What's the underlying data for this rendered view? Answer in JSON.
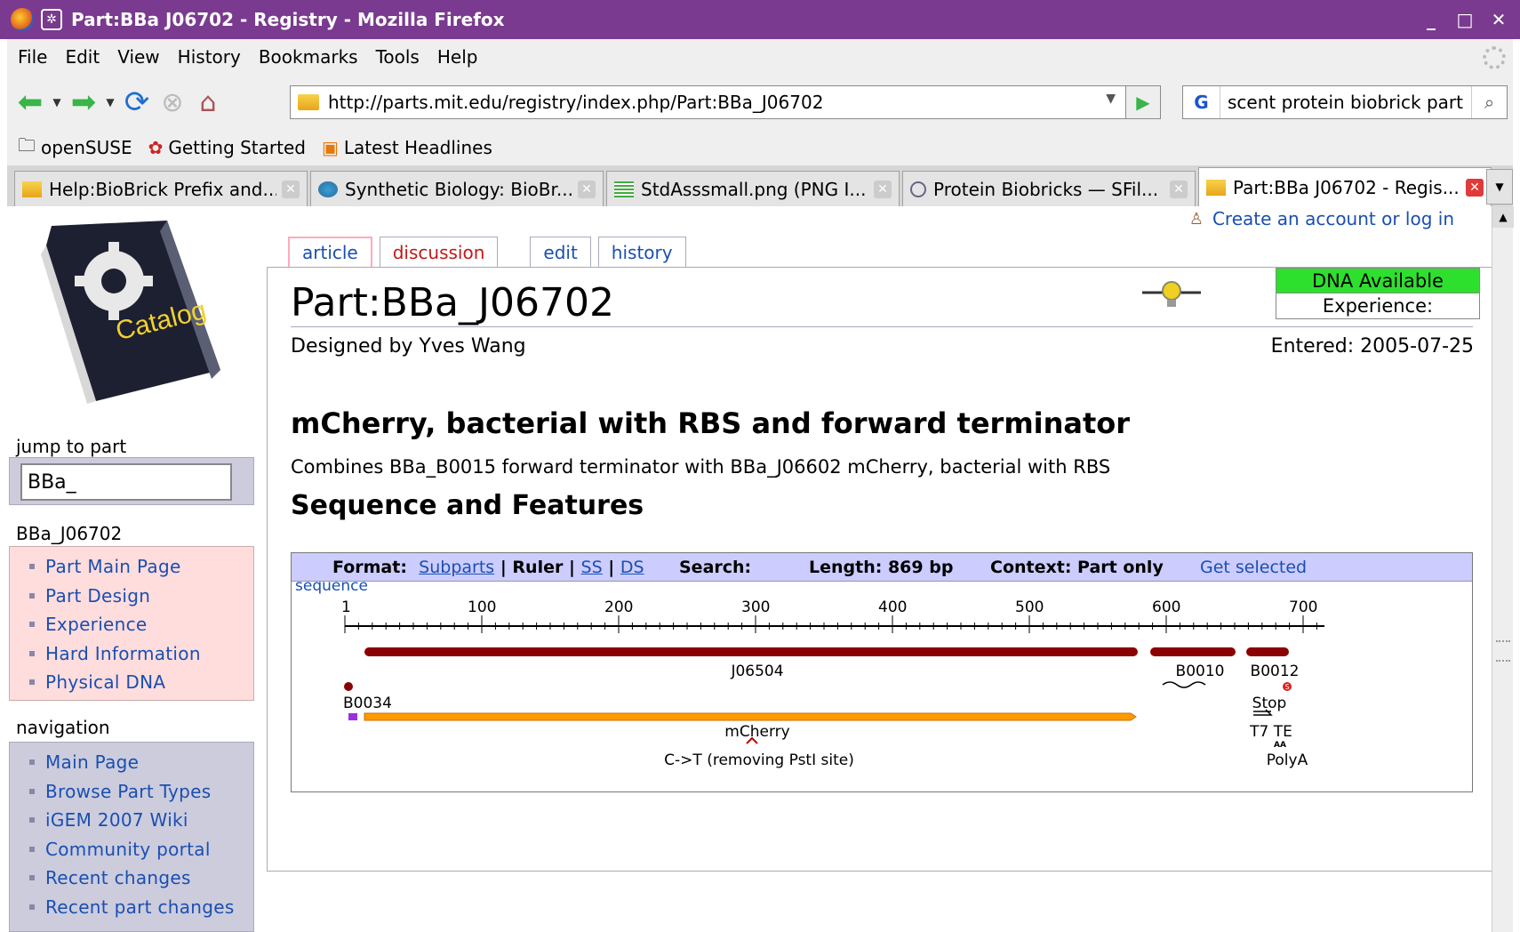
{
  "window": {
    "title": "Part:BBa J06702 - Registry - Mozilla Firefox",
    "controls": [
      "_",
      "□",
      "✕"
    ]
  },
  "menu": [
    "File",
    "Edit",
    "View",
    "History",
    "Bookmarks",
    "Tools",
    "Help"
  ],
  "nav": {
    "url": "http://parts.mit.edu/registry/index.php/Part:BBa_J06702",
    "search_engine": "G",
    "search_query": "scent protein biobrick part"
  },
  "bookmarks": [
    "openSUSE",
    "Getting Started",
    "Latest Headlines"
  ],
  "tabs": [
    {
      "label": "Help:BioBrick Prefix and...",
      "active": false
    },
    {
      "label": "Synthetic Biology: BioBr...",
      "active": false
    },
    {
      "label": "StdAsssmall.png (PNG I...",
      "active": false
    },
    {
      "label": "Protein Biobricks — SFil...",
      "active": false
    },
    {
      "label": "Part:BBa J06702 - Regis...",
      "active": true
    }
  ],
  "sidebar": {
    "logo_text": "Catalog",
    "jump_label": "jump to part",
    "jump_value": "BBa_",
    "part_label": "BBa_J06702",
    "part_links": [
      "Part Main Page",
      "Part Design",
      "Experience",
      "Hard Information",
      "Physical DNA"
    ],
    "nav_label": "navigation",
    "nav_links": [
      "Main Page",
      "Browse Part Types",
      "iGEM 2007 Wiki",
      "Community portal",
      "Recent changes",
      "Recent part changes"
    ]
  },
  "login": "Create an account or log in",
  "page_tabs": [
    "article",
    "discussion",
    "edit",
    "history"
  ],
  "article": {
    "title": "Part:BBa_J06702",
    "designer": "Designed by Yves Wang",
    "entered": "Entered: 2005-07-25",
    "dna_status": "DNA Available",
    "experience": "Experience:",
    "heading": "mCherry, bacterial with RBS and forward terminator",
    "description": "Combines BBa_B0015 forward terminator with BBa_J06602 mCherry, bacterial with RBS",
    "seq_heading": "Sequence and Features"
  },
  "seqviewer": {
    "format_label": "Format:",
    "subparts": "Subparts",
    "sep1": "|",
    "ruler": "Ruler",
    "sep2": "|",
    "ss": "SS",
    "sep3": "|",
    "ds": "DS",
    "search_label": "Search:",
    "length": "Length: 869 bp",
    "context": "Context: Part only",
    "get_selected": "Get selected",
    "sequence_link": "sequence",
    "ruler_ticks": [
      "1",
      "100",
      "200",
      "300",
      "400",
      "500",
      "600",
      "700"
    ],
    "features": {
      "j06504": "J06504",
      "b0010": "B0010",
      "b0012": "B0012",
      "b0034": "B0034",
      "mcherry": "mCherry",
      "stop": "Stop",
      "t7te": "T7 TE",
      "mutation": "C->T (removing PstI site)",
      "polya": "PolyA",
      "aa_mark": "AA",
      "s_mark": "S"
    },
    "colors": {
      "part": "#8b0000",
      "cds": "#ff9a00",
      "rbs": "#9a2fe0"
    }
  }
}
